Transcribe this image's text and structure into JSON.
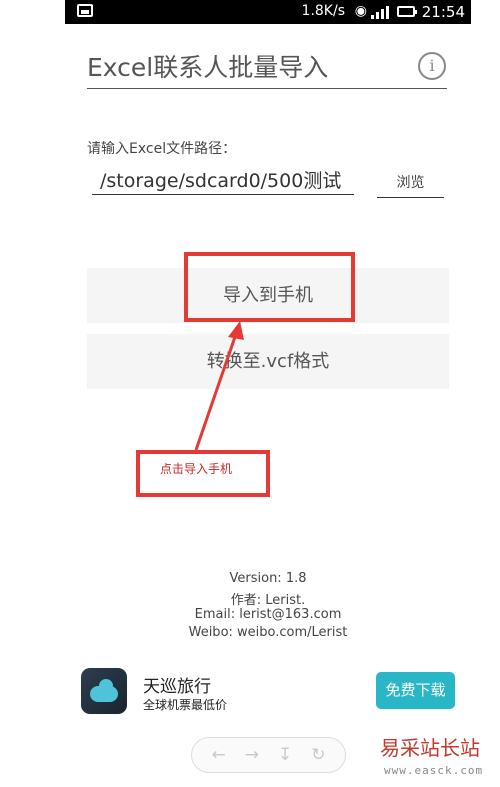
{
  "status": {
    "speed": "1.8K/s",
    "time": "21:54"
  },
  "app": {
    "title": "Excel联系人批量导入"
  },
  "form": {
    "path_label": "请输入Excel文件路径：",
    "path_value": "/storage/sdcard0/500测试",
    "browse_label": "浏览"
  },
  "buttons": {
    "import_phone": "导入到手机",
    "convert_vcf": "转换至.vcf格式"
  },
  "about": {
    "version": "Version: 1.8",
    "author": "作者: Lerist.",
    "email": "Email: lerist@163.com",
    "weibo": "Weibo: weibo.com/Lerist"
  },
  "ad": {
    "title": "天巡旅行",
    "subtitle": "全球机票最低价",
    "button": "免费下载"
  },
  "annotation": {
    "text": "点击导入手机"
  },
  "watermark": {
    "name": "易采站长站",
    "url": "www.easck.com"
  },
  "colors": {
    "annotation_red": "#e53935",
    "ad_button": "#29b6c6"
  },
  "icons": [
    "image-icon",
    "wifi-icon",
    "signal-icon",
    "battery-icon",
    "info-icon",
    "back-icon",
    "forward-icon",
    "download-icon",
    "refresh-icon"
  ]
}
